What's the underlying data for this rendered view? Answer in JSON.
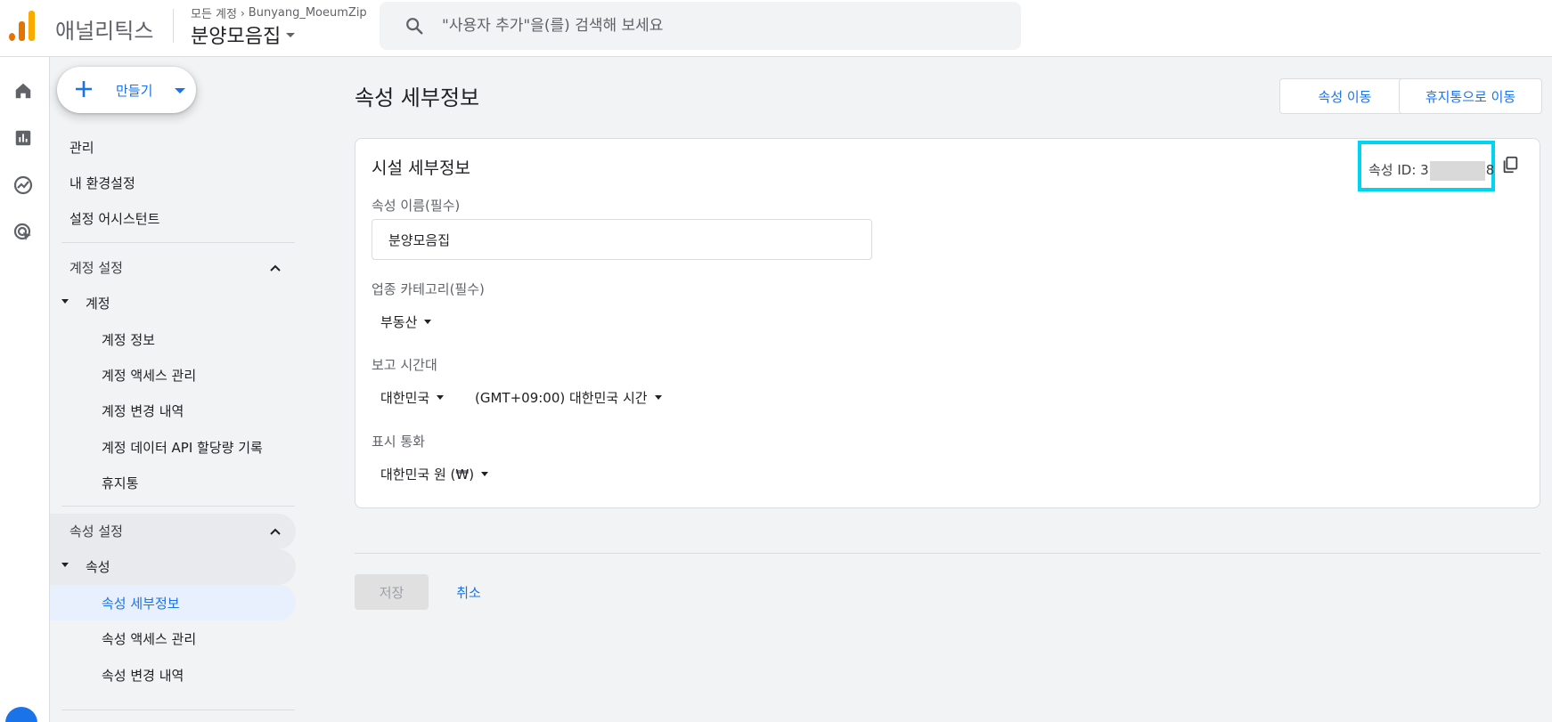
{
  "header": {
    "app_name": "애널리틱스",
    "breadcrumb_all": "모든 계정",
    "breadcrumb_account": "Bunyang_MoeumZip",
    "property_name": "분양모음집",
    "search_placeholder": "\"사용자 추가\"을(를) 검색해 보세요"
  },
  "rail": {
    "items": [
      "home-icon",
      "reports-icon",
      "explore-icon",
      "advertising-icon",
      "admin-gear-icon"
    ]
  },
  "sidenav": {
    "create_label": "만들기",
    "top_items": [
      "관리",
      "내 환경설정",
      "설정 어시스턴트"
    ],
    "account_section": {
      "header": "계정 설정",
      "group": "계정",
      "items": [
        "계정 정보",
        "계정 액세스 관리",
        "계정 변경 내역",
        "계정 데이터 API 할당량 기록",
        "휴지통"
      ]
    },
    "property_section": {
      "header": "속성 설정",
      "group": "속성",
      "items": [
        "속성 세부정보",
        "속성 액세스 관리",
        "속성 변경 내역"
      ],
      "active": "속성 세부정보"
    }
  },
  "main": {
    "title": "속성 세부정보",
    "move_property": "속성 이동",
    "move_to_trash": "휴지통으로 이동",
    "card": {
      "title": "시설 세부정보",
      "property_id_prefix": "속성 ID: 3",
      "property_id_suffix": "8",
      "name_label": "속성 이름(필수)",
      "name_value": "분양모음집",
      "industry_label": "업종 카테고리(필수)",
      "industry_value": "부동산",
      "timezone_label": "보고 시간대",
      "timezone_country": "대한민국",
      "timezone_value": "(GMT+09:00) 대한민국 시간",
      "currency_label": "표시 통화",
      "currency_value": "대한민국 원 (₩)"
    },
    "save_label": "저장",
    "cancel_label": "취소"
  },
  "colors": {
    "accent": "#1a73e8",
    "highlight_box": "#00d4f0",
    "active_nav_bg": "#e8f0fe"
  }
}
